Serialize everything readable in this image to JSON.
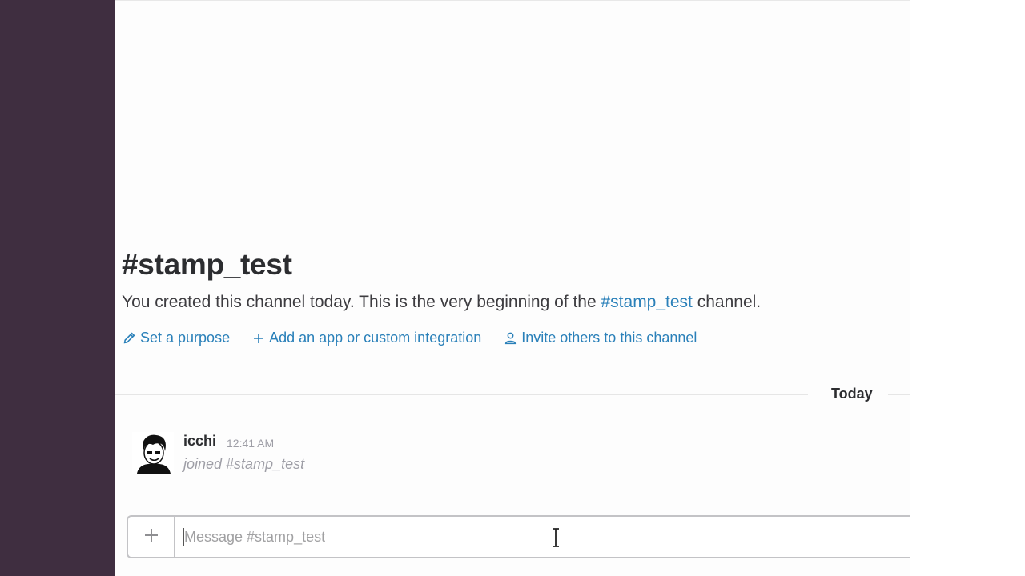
{
  "channel": {
    "title": "#stamp_test",
    "intro_prefix": "You created this channel today. This is the very beginning of the ",
    "intro_link": "#stamp_test",
    "intro_suffix": " channel."
  },
  "actions": {
    "set_purpose": "Set a purpose",
    "add_app": "Add an app or custom integration",
    "invite": "Invite others to this channel"
  },
  "day_divider": "Today",
  "message": {
    "user": "icchi",
    "time": "12:41 AM",
    "text": "joined #stamp_test"
  },
  "composer": {
    "placeholder": "Message #stamp_test"
  },
  "colors": {
    "sidebar": "#3f2e40",
    "link": "#2a80b9"
  }
}
